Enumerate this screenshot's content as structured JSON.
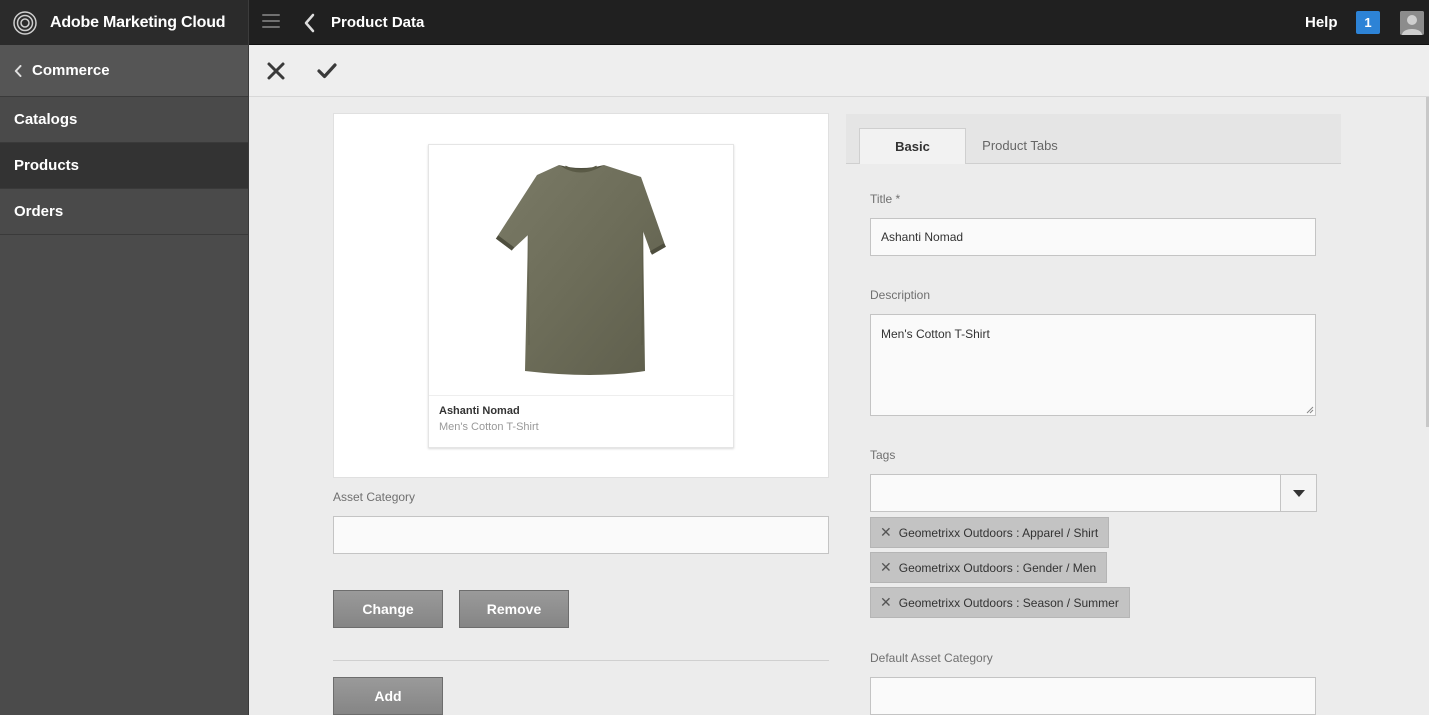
{
  "header": {
    "brand": "Adobe Marketing Cloud",
    "page_title": "Product Data",
    "help": "Help",
    "notifications": "1"
  },
  "sidebar": {
    "back_label": "Commerce",
    "items": [
      {
        "label": "Catalogs"
      },
      {
        "label": "Products"
      },
      {
        "label": "Orders"
      }
    ]
  },
  "product_card": {
    "title": "Ashanti Nomad",
    "description": "Men's Cotton T-Shirt"
  },
  "left_form": {
    "asset_category_label": "Asset Category",
    "asset_category_value": "",
    "change_button": "Change",
    "remove_button": "Remove",
    "add_button": "Add"
  },
  "tabs": [
    {
      "label": "Basic"
    },
    {
      "label": "Product Tabs"
    }
  ],
  "basic_form": {
    "title_label": "Title *",
    "title_value": "Ashanti Nomad",
    "description_label": "Description",
    "description_value": "Men's Cotton T-Shirt",
    "tags_label": "Tags",
    "tags_value": "",
    "tags": [
      "Geometrixx Outdoors : Apparel / Shirt",
      "Geometrixx Outdoors : Gender / Men",
      "Geometrixx Outdoors : Season / Summer"
    ],
    "default_asset_category_label": "Default Asset Category",
    "default_asset_category_value": ""
  },
  "colors": {
    "topbar": "#202020",
    "sidebar": "#4b4b4b",
    "sidebar_active": "#333333",
    "accent_badge": "#2d83d6",
    "button": "#8f8f8f",
    "tag": "#c3c3c3"
  },
  "icons": {
    "brand_logo": "adobe-marketing-cloud-logo",
    "menu": "hamburger-icon",
    "back": "chevron-left-icon",
    "close": "close-icon",
    "save": "checkmark-icon",
    "tag_remove": "close-icon",
    "dropdown": "caret-down-icon",
    "user": "user-avatar-icon"
  }
}
